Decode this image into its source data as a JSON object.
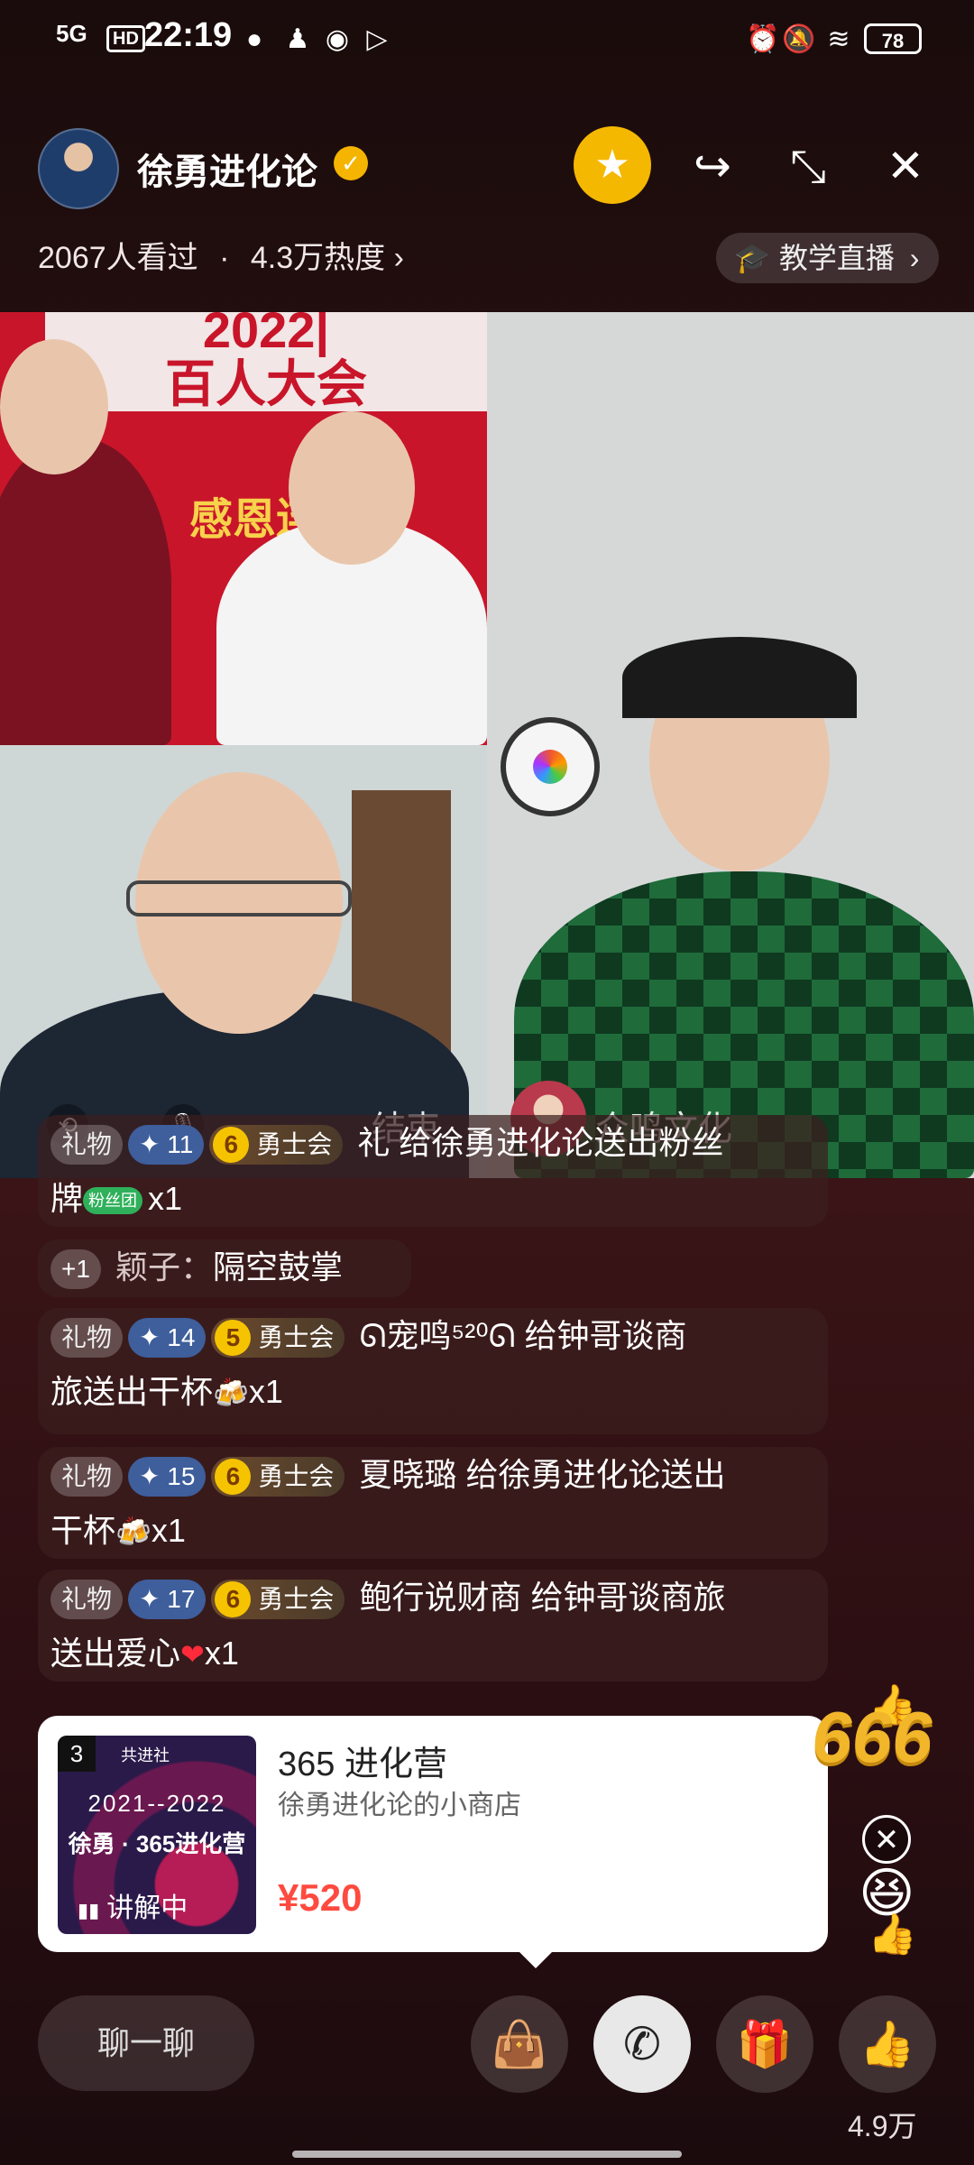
{
  "status_bar": {
    "network": "5G",
    "hd": "HD",
    "time": "22:19",
    "battery": "78",
    "icons": [
      "wechat-icon",
      "qq-icon",
      "compass-icon",
      "play-icon",
      "alarm-icon",
      "mute-icon",
      "wifi-icon"
    ]
  },
  "header": {
    "anchor_name": "徐勇进化论",
    "viewers": "2067人看过",
    "separator": "·",
    "heat": "4.3万热度",
    "heat_chevron": "›",
    "category": "教学直播",
    "category_chevron": "›"
  },
  "video": {
    "banner_line1": "2022|",
    "banner_line2": "百人大会",
    "banner_sub": "感恩连",
    "end_label": "结束",
    "guest_name": "众鸣文化"
  },
  "chat": [
    {
      "tag": "礼物",
      "level": "11",
      "fan_level": "6",
      "fan_club": "勇士会",
      "text": "礼 给徐勇进化论送出粉丝",
      "text2": "牌",
      "badge": "粉丝团",
      "count": "x1"
    },
    {
      "plus": "+1",
      "user": "颖子：",
      "text": "隔空鼓掌"
    },
    {
      "tag": "礼物",
      "level": "14",
      "fan_level": "5",
      "fan_club": "勇士会",
      "text": "ᘏ宠鸣⁵²⁰ᘏ 给钟哥谈商",
      "text2": "旅送出干杯",
      "emoji": "🍻",
      "count": "x1"
    },
    {
      "tag": "礼物",
      "level": "15",
      "fan_level": "6",
      "fan_club": "勇士会",
      "text": "夏晓璐 给徐勇进化论送出",
      "text2": "干杯",
      "emoji": "🍻",
      "count": "x1"
    },
    {
      "tag": "礼物",
      "level": "17",
      "fan_level": "6",
      "fan_club": "勇士会",
      "text": "鲍行说财商 给钟哥谈商旅",
      "text2": "送出爱心",
      "emoji": "❤",
      "count": "x1"
    }
  ],
  "product": {
    "index": "3",
    "logo": "共进社",
    "years": "2021--2022",
    "thumb_title": "徐勇 · 365进化营",
    "explaining": "讲解中",
    "title": "365 进化营",
    "shop": "徐勇进化论的小商店",
    "price": "¥520"
  },
  "sticker": "666",
  "bottom": {
    "chat_placeholder": "聊一聊",
    "likes": "4.9万"
  }
}
